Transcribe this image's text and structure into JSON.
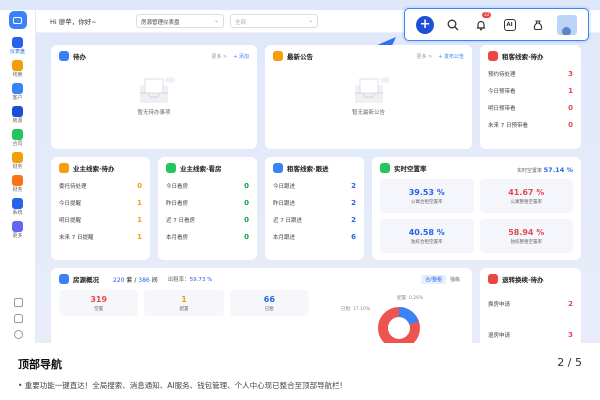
{
  "sidebar": {
    "items": [
      {
        "label": "仪表盘",
        "color": "#2563eb"
      },
      {
        "label": "线索",
        "color": "#f59e0b"
      },
      {
        "label": "客户",
        "color": "#3b82f6"
      },
      {
        "label": "房源",
        "color": "#1d4ed8"
      },
      {
        "label": "合同",
        "color": "#22c55e"
      },
      {
        "label": "财务",
        "color": "#f59e0b"
      },
      {
        "label": "财务",
        "color": "#f97316"
      },
      {
        "label": "系统",
        "color": "#2563eb"
      },
      {
        "label": "更多",
        "color": "#6366f1"
      }
    ]
  },
  "topbar": {
    "greeting": "Hi 廖苹，你好~",
    "dashboard_select": "房源管理仪表盘",
    "scope_placeholder": "全部",
    "ai_label": "AI",
    "notif_badge": "22"
  },
  "cards": {
    "todo": {
      "title": "待办",
      "more": "更多 >",
      "add": "+ 添加",
      "empty": "暂无待办事项"
    },
    "notice": {
      "title": "最新公告",
      "more": "更多 >",
      "add": "+ 发布公告",
      "empty": "暂无最新公告"
    },
    "rent_pending": {
      "title": "租客线索·待办",
      "rows": [
        {
          "label": "预约待处理",
          "value": "3",
          "color": "red"
        },
        {
          "label": "今日预带看",
          "value": "1",
          "color": "red"
        },
        {
          "label": "明日预带看",
          "value": "0",
          "color": "red"
        },
        {
          "label": "未来 7 日预带看",
          "value": "0",
          "color": "red"
        }
      ]
    },
    "owner_pending": {
      "title": "业主线索·待办",
      "rows": [
        {
          "label": "委托待处理",
          "value": "0",
          "color": "orange"
        },
        {
          "label": "今日提醒",
          "value": "1",
          "color": "orange"
        },
        {
          "label": "明日提醒",
          "value": "1",
          "color": "orange"
        },
        {
          "label": "未来 7 日提醒",
          "value": "1",
          "color": "orange"
        }
      ]
    },
    "owner_viewing": {
      "title": "业主线索·看房",
      "rows": [
        {
          "label": "今日看房",
          "value": "0",
          "color": "green"
        },
        {
          "label": "昨日看房",
          "value": "0",
          "color": "green"
        },
        {
          "label": "近 7 日看房",
          "value": "0",
          "color": "green"
        },
        {
          "label": "本月看房",
          "value": "0",
          "color": "green"
        }
      ]
    },
    "rent_follow": {
      "title": "租客线索·跟进",
      "rows": [
        {
          "label": "今日跟进",
          "value": "2",
          "color": "blue2"
        },
        {
          "label": "昨日跟进",
          "value": "2",
          "color": "blue2"
        },
        {
          "label": "近 7 日跟进",
          "value": "2",
          "color": "blue2"
        },
        {
          "label": "本月跟进",
          "value": "6",
          "color": "blue2"
        }
      ]
    },
    "vacancy": {
      "title": "实时空置率",
      "total_label": "实时空置率",
      "total_value": "57.14 %",
      "cells": [
        {
          "value": "39.53 %",
          "label": "公寓合租空置率",
          "color": "blue2"
        },
        {
          "value": "41.67 %",
          "label": "公寓整租空置率",
          "color": "red"
        },
        {
          "value": "40.58 %",
          "label": "独栋合租空置率",
          "color": "blue2"
        },
        {
          "value": "58.94 %",
          "label": "独栋整租空置率",
          "color": "red"
        }
      ]
    },
    "overview": {
      "title": "房源概况",
      "count_a": "220",
      "unit_a": "套",
      "sep": "/",
      "count_b": "386",
      "unit_b": "间",
      "rent_label": "出租率：",
      "rent_value": "59.73 %",
      "toggle_a": "合/整租",
      "toggle_b": "独栋",
      "stats": [
        {
          "value": "319",
          "label": "空置",
          "color": "red"
        },
        {
          "value": "1",
          "label": "配置",
          "color": "orange"
        },
        {
          "value": "66",
          "label": "已租",
          "color": "blue2"
        }
      ],
      "donut_label_a": "已租: 17.10%",
      "donut_label_b": "配置: 0.26%"
    },
    "transfer": {
      "title": "退转换续·待办",
      "rows": [
        {
          "label": "换房申请",
          "value": "2",
          "color": "red"
        },
        {
          "label": "退房申请",
          "value": "3",
          "color": "red"
        }
      ]
    }
  },
  "caption": {
    "title": "顶部导航",
    "page": "2 / 5",
    "desc": "• 重要功能一键直达！全局搜索、消息通知、AI服务、钱包管理、个人中心现已整合至顶部导航栏!"
  }
}
